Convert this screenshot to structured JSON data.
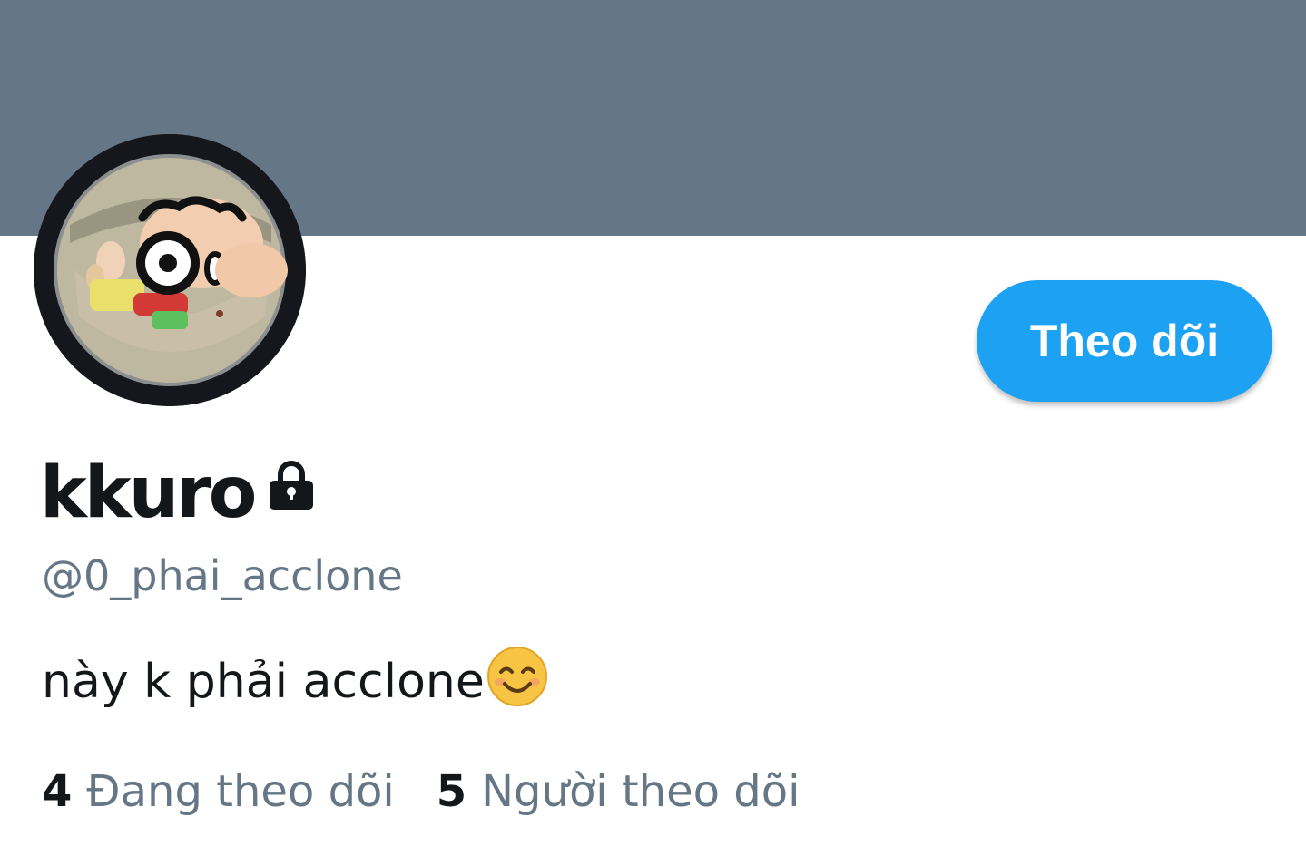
{
  "profile": {
    "display_name": "kkuro",
    "handle": "@0_phai_acclone",
    "bio": "này k phải acclone",
    "bio_emoji": "smiling-face-emoji",
    "protected_icon": "lock-icon"
  },
  "actions": {
    "follow_label": "Theo dõi"
  },
  "stats": {
    "following_count": "4",
    "following_label": "Đang theo dõi",
    "followers_count": "5",
    "followers_label": "Người theo dõi"
  },
  "colors": {
    "banner": "#657786",
    "accent": "#1da1f2",
    "text_primary": "#14171a",
    "text_secondary": "#657786"
  }
}
